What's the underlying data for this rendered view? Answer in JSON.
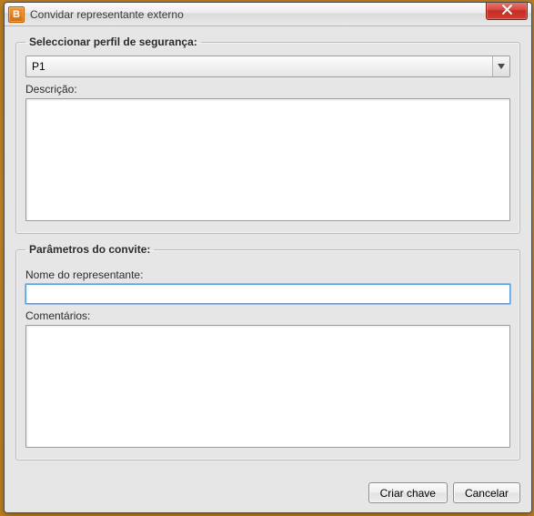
{
  "window": {
    "title": "Convidar representante externo",
    "icon_letter": "B"
  },
  "group_security": {
    "legend": "Seleccionar perfil de segurança:",
    "profile_value": "P1",
    "description_label": "Descrição:",
    "description_value": ""
  },
  "group_invite": {
    "legend": "Parâmetros do convite:",
    "rep_name_label": "Nome do representante:",
    "rep_name_value": "",
    "comments_label": "Comentários:",
    "comments_value": ""
  },
  "buttons": {
    "create_key": "Criar chave",
    "cancel": "Cancelar"
  }
}
